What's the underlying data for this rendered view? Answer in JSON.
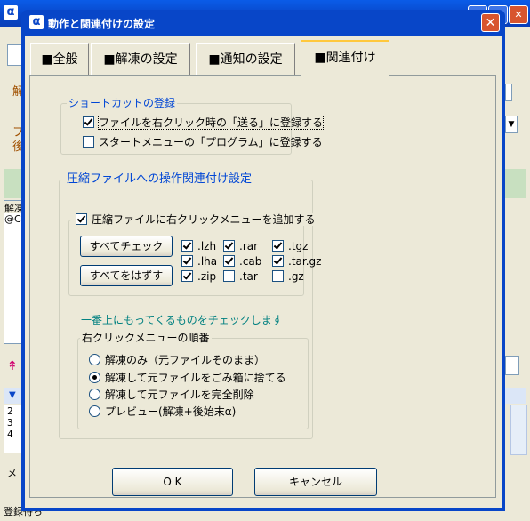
{
  "background_app": {
    "logo": "α",
    "left_labels": [
      "解",
      "フ",
      "後"
    ],
    "list_header": "解凍",
    "list_item": "@C",
    "line_numbers": [
      "2",
      "3",
      "4"
    ],
    "status_text": "登録待ち",
    "bottom_label": "メ"
  },
  "dialog": {
    "logo": "α",
    "title": "動作と関連付けの設定",
    "close_glyph": "✕",
    "tabs": [
      {
        "label": "■全般",
        "active": false
      },
      {
        "label": "■解凍の設定",
        "active": false
      },
      {
        "label": "■通知の設定",
        "active": false
      },
      {
        "label": "■関連付け",
        "active": true
      }
    ],
    "shortcut_group": {
      "title": "ショートカットの登録",
      "items": [
        {
          "label": "ファイルを右クリック時の「送る」に登録する",
          "checked": true
        },
        {
          "label": "スタートメニューの「プログラム」に登録する",
          "checked": false
        }
      ]
    },
    "assoc_group": {
      "title": "圧縮ファイルへの操作関連付け設定",
      "add_menu": {
        "label": "圧縮ファイルに右クリックメニューを追加する",
        "checked": true
      },
      "check_all_button": "すべてチェック",
      "uncheck_all_button": "すべてをはずす",
      "extensions": [
        {
          "label": ".lzh",
          "checked": true
        },
        {
          "label": ".lha",
          "checked": true
        },
        {
          "label": ".zip",
          "checked": true
        },
        {
          "label": ".rar",
          "checked": true
        },
        {
          "label": ".cab",
          "checked": true
        },
        {
          "label": ".tar",
          "checked": false
        },
        {
          "label": ".tgz",
          "checked": true
        },
        {
          "label": ".tar.gz",
          "checked": true
        },
        {
          "label": ".gz",
          "checked": false
        }
      ],
      "note": "一番上にもってくるものをチェックします",
      "menu_order_group": {
        "title": "右クリックメニューの順番",
        "options": [
          {
            "label": "解凍のみ（元ファイルそのまま）",
            "selected": false
          },
          {
            "label": "解凍して元ファイルをごみ箱に捨てる",
            "selected": true
          },
          {
            "label": "解凍して元ファイルを完全削除",
            "selected": false
          },
          {
            "label": "プレビュー(解凍+後始末α)",
            "selected": false
          }
        ]
      }
    },
    "ok_button": "O K",
    "cancel_button": "キャンセル"
  }
}
